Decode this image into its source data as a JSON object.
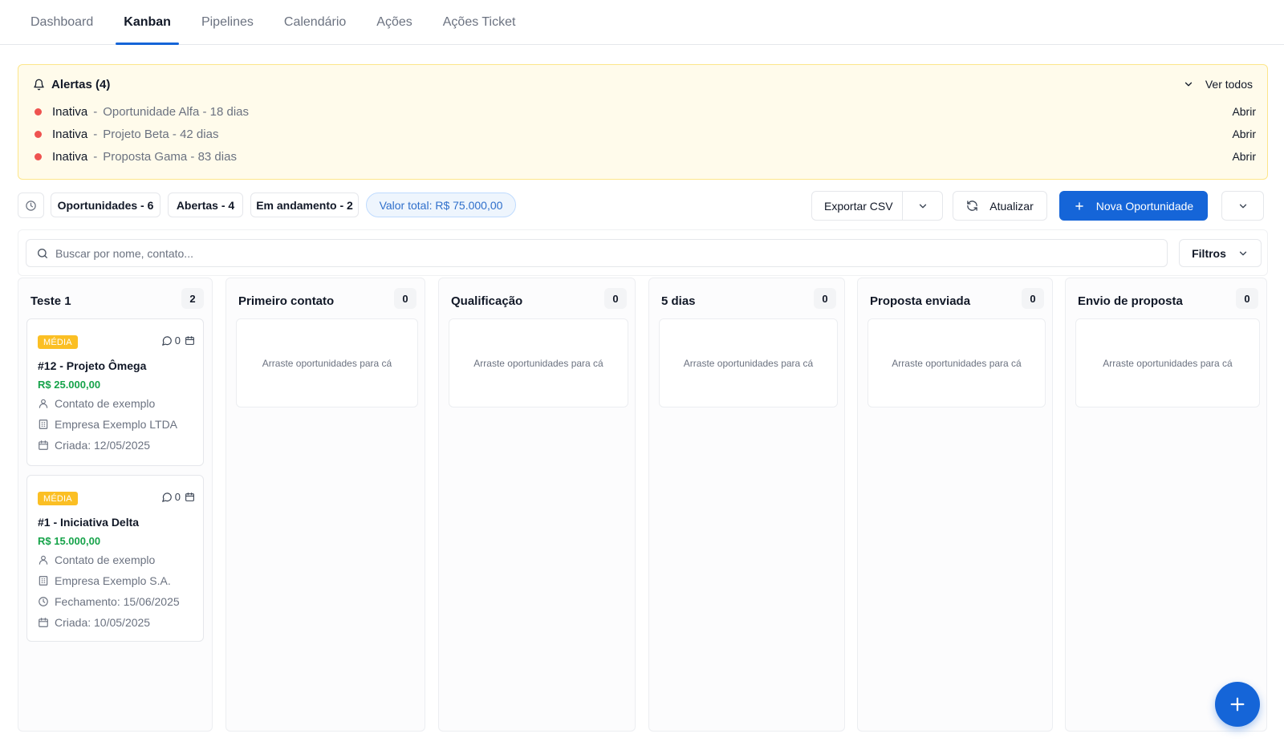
{
  "tabs": [
    "Dashboard",
    "Kanban",
    "Pipelines",
    "Calendário",
    "Ações",
    "Ações Ticket"
  ],
  "active_tab": "Kanban",
  "alerts": {
    "title": "Alertas (4)",
    "view_all": "Ver todos",
    "items": [
      {
        "status": "Inativa",
        "sep": "-",
        "text": "Oportunidade Alfa - 18 dias",
        "action": "Abrir"
      },
      {
        "status": "Inativa",
        "sep": "-",
        "text": "Projeto Beta - 42 dias",
        "action": "Abrir"
      },
      {
        "status": "Inativa",
        "sep": "-",
        "text": "Proposta Gama - 83 dias",
        "action": "Abrir"
      }
    ]
  },
  "stats": {
    "opportunities": "Oportunidades - 6",
    "open": "Abertas - 4",
    "in_progress": "Em andamento - 2",
    "total_value": "Valor total: R$ 75.000,00"
  },
  "toolbar": {
    "export_label": "Exportar CSV",
    "refresh_label": "Atualizar",
    "new_label": "Nova Oportunidade"
  },
  "search": {
    "placeholder": "Buscar por nome, contato...",
    "filters_label": "Filtros"
  },
  "columns": [
    {
      "title": "Teste 1",
      "count": "2",
      "cards": [
        {
          "priority": "MÉDIA",
          "comments": "0",
          "title": "#12 - Projeto Ômega",
          "value": "R$ 25.000,00",
          "contact": "Contato de exemplo",
          "company": "Empresa Exemplo LTDA",
          "created": "Criada: 12/05/2025"
        },
        {
          "priority": "MÉDIA",
          "comments": "0",
          "title": "#1 - Iniciativa Delta",
          "value": "R$ 15.000,00",
          "contact": "Contato de exemplo",
          "company": "Empresa Exemplo S.A.",
          "closing": "Fechamento: 15/06/2025",
          "created": "Criada: 10/05/2025"
        }
      ]
    },
    {
      "title": "Primeiro contato",
      "count": "0",
      "empty_text": "Arraste oportunidades para cá"
    },
    {
      "title": "Qualificação",
      "count": "0",
      "empty_text": "Arraste oportunidades para cá"
    },
    {
      "title": "5 dias",
      "count": "0",
      "empty_text": "Arraste oportunidades para cá"
    },
    {
      "title": "Proposta enviada",
      "count": "0",
      "empty_text": "Arraste oportunidades para cá"
    },
    {
      "title": "Envio de proposta",
      "count": "0",
      "empty_text": "Arraste oportunidades para cá"
    }
  ],
  "colors": {
    "primary": "#1565d8",
    "alert_bg": "#fffbeb",
    "alert_dot": "#ef5350",
    "priority_medium": "#fbbf24",
    "money": "#16a34a"
  },
  "icons": [
    "bell-icon",
    "chevron-down-icon",
    "history-icon",
    "refresh-icon",
    "plus-icon",
    "search-icon",
    "comment-icon",
    "calendar-icon",
    "user-icon",
    "building-icon",
    "clock-icon"
  ]
}
